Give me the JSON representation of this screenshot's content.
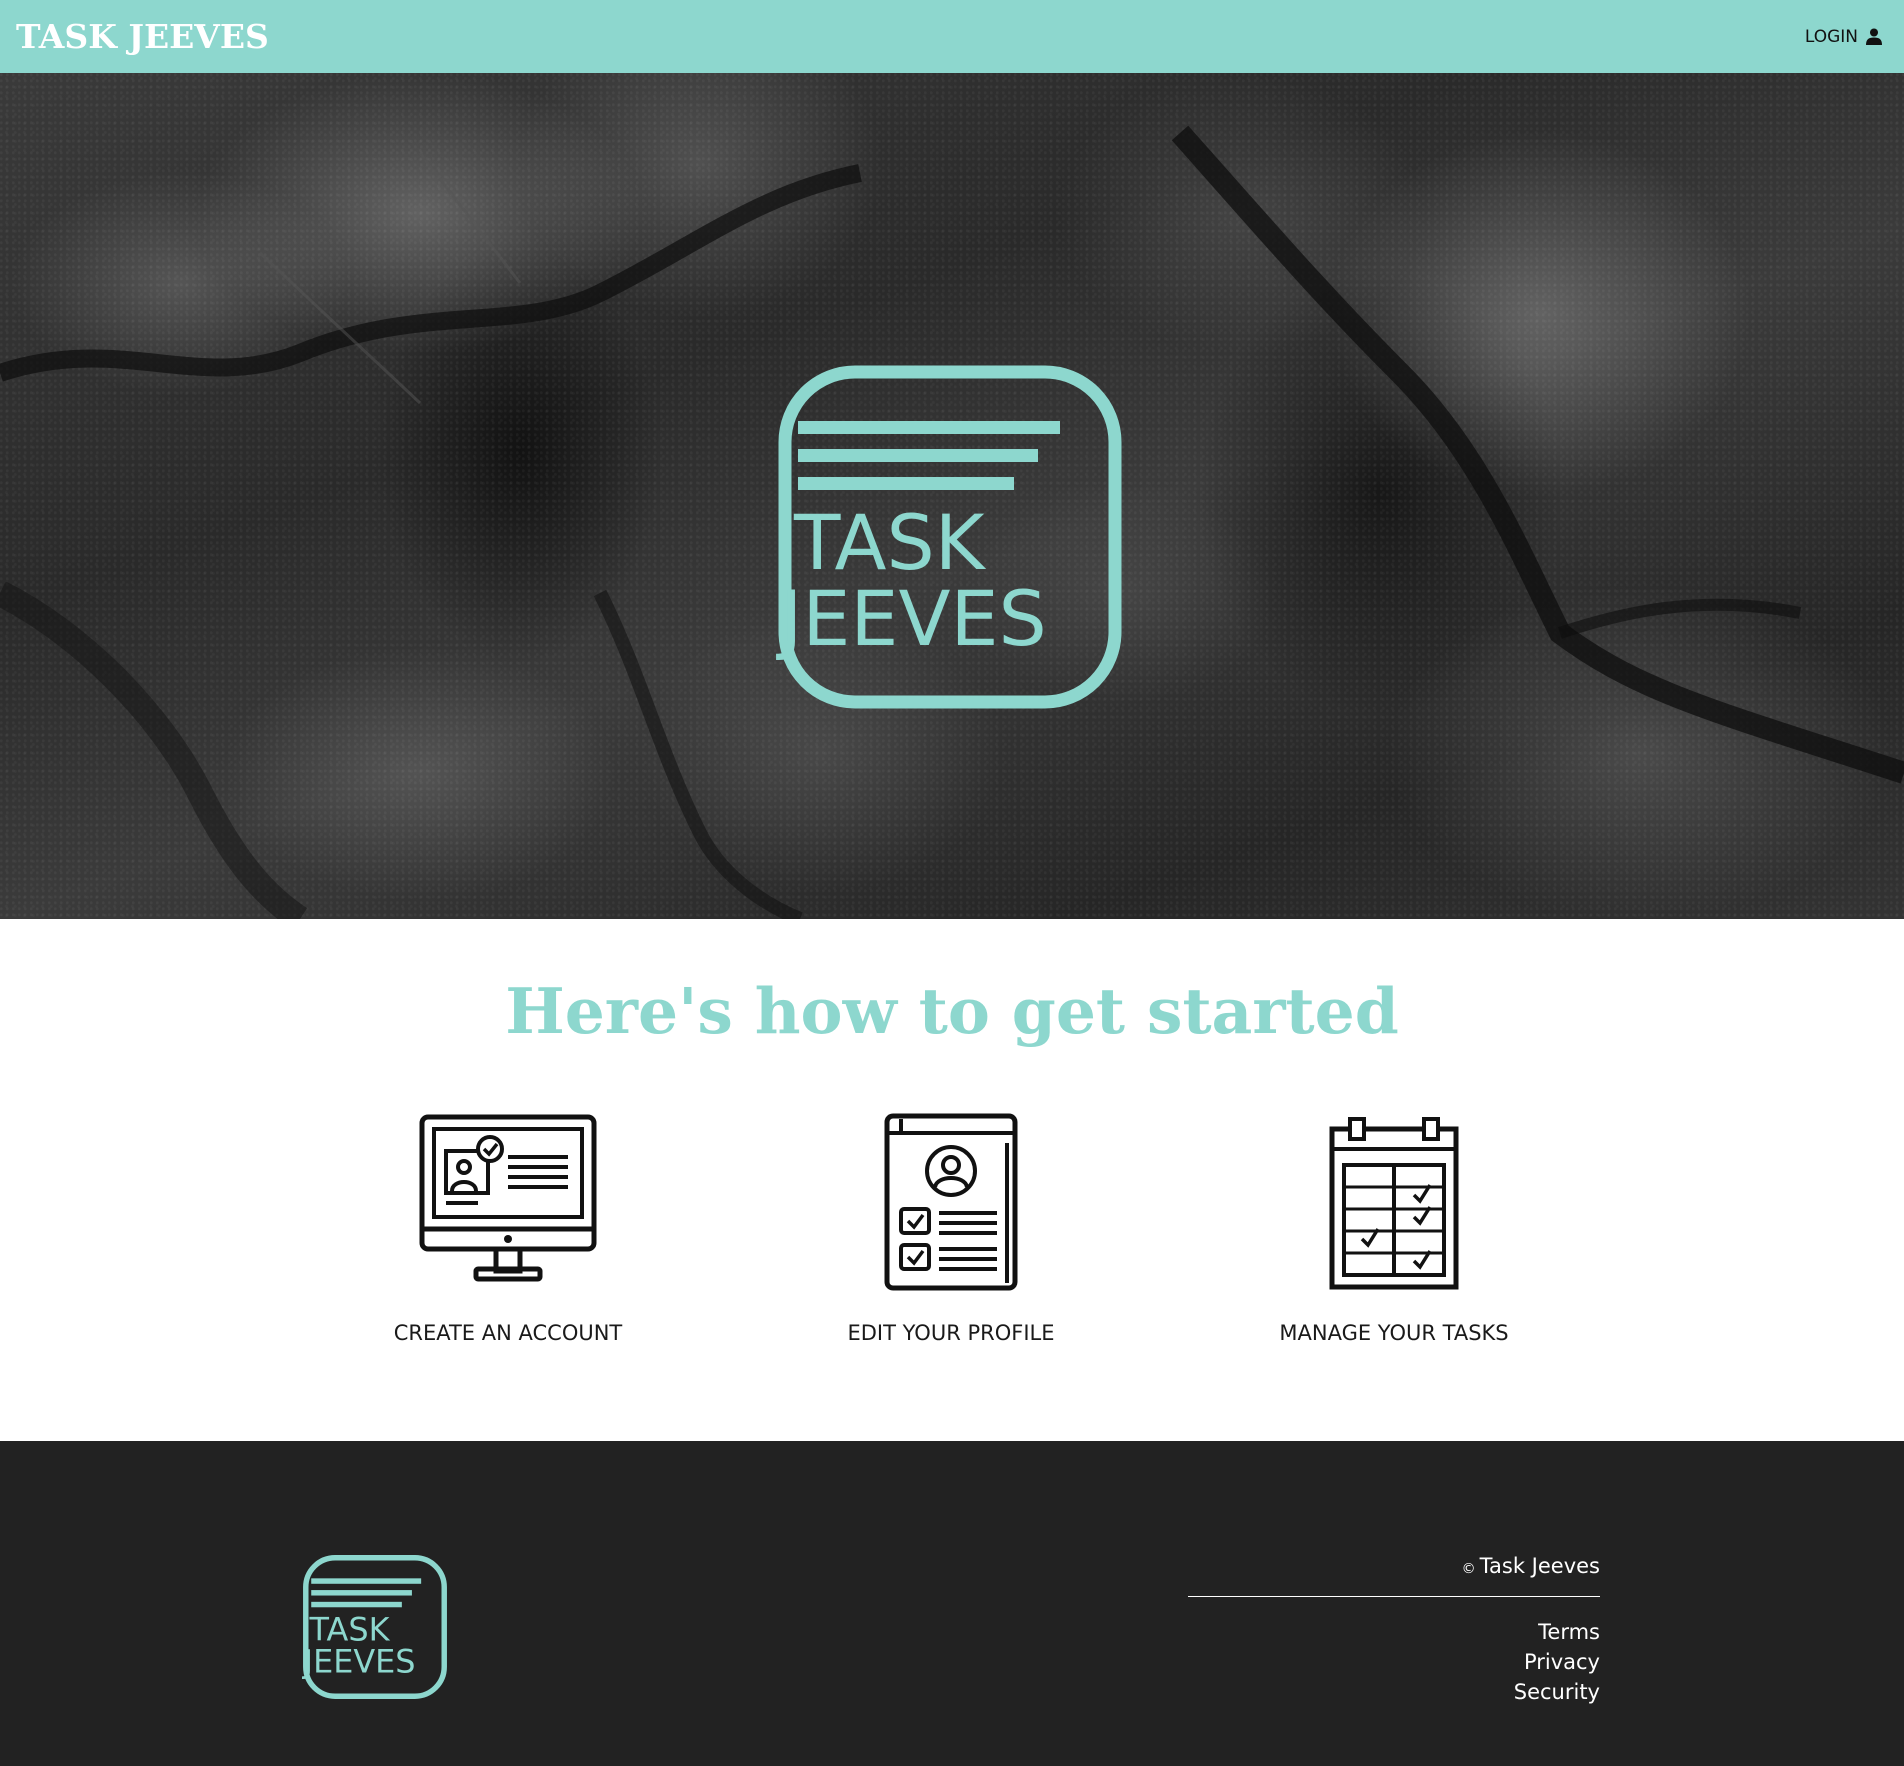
{
  "header": {
    "brand": "TASK JEEVES",
    "login_label": "LOGIN"
  },
  "hero": {
    "logo": {
      "line1": "TASK",
      "line2": "JEEVES"
    }
  },
  "getting_started": {
    "title": "Here's how to get started",
    "steps": [
      {
        "label": "CREATE AN ACCOUNT",
        "icon": "monitor-account-icon"
      },
      {
        "label": "EDIT YOUR PROFILE",
        "icon": "profile-document-icon"
      },
      {
        "label": "MANAGE YOUR TASKS",
        "icon": "calendar-checklist-icon"
      }
    ]
  },
  "footer": {
    "logo": {
      "line1": "TASK",
      "line2": "JEEVES"
    },
    "copyright_symbol": "©",
    "copyright_text": "Task Jeeves",
    "links": [
      "Terms",
      "Privacy",
      "Security"
    ]
  },
  "colors": {
    "accent": "#8dd7ce",
    "footer_bg": "#222222",
    "text_dark": "#1a1a1a"
  }
}
